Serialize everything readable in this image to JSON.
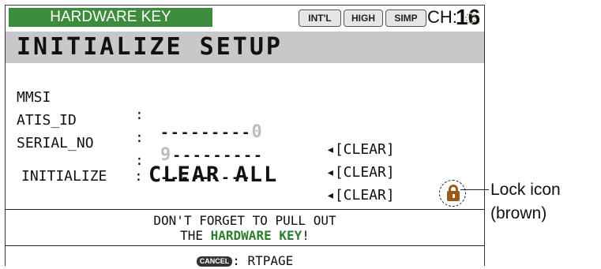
{
  "header": {
    "hardware_key": "HARDWARE KEY",
    "badges": [
      "INT'L",
      "HIGH",
      "SIMP"
    ],
    "channel_label": "CH:",
    "channel_number": "16"
  },
  "title": "INITIALIZE SETUP",
  "fields": [
    {
      "label": "MMSI",
      "colon": ":",
      "value_dashes": "---------",
      "value_digit": "0",
      "action": "◂[CLEAR]"
    },
    {
      "label": "ATIS_ID",
      "colon": ":",
      "value_digit": "9",
      "value_dashes": "---------",
      "action": "◂[CLEAR]"
    },
    {
      "label": "SERIAL_NO",
      "colon": ":",
      "value_dashes": "---------",
      "action": "◂[CLEAR]"
    }
  ],
  "initialize": {
    "label": "INITIALIZE",
    "colon": ":",
    "value": "CLEAR ALL"
  },
  "warning": {
    "line1": "DON'T FORGET TO PULL OUT",
    "line2_prefix": "THE ",
    "line2_highlight": "HARDWARE KEY",
    "line2_suffix": "!"
  },
  "footer": {
    "key_label": "CANCEL",
    "text": ": RTPAGE"
  },
  "callout": {
    "line1": "Lock icon",
    "line2": "(brown)"
  },
  "icons": {
    "lock": "lock-icon",
    "spinner": "busy-spinner-icon"
  },
  "colors": {
    "hardware_key_bg": "#3d8c3d",
    "highlight_text": "#2e7d2e",
    "lock": "#9a5a1c",
    "title_bg": "#c8c8c8"
  }
}
